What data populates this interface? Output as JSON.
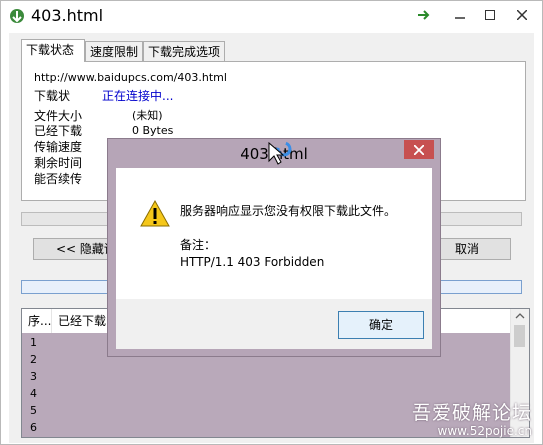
{
  "window": {
    "title": "403.html"
  },
  "tabs": [
    {
      "label": "下载状态"
    },
    {
      "label": "速度限制"
    },
    {
      "label": "下载完成选项"
    }
  ],
  "status": {
    "url": "http://www.baidupcs.com/403.html",
    "state_label": "下载状",
    "state_value": "正在连接中...",
    "rows": [
      {
        "label": "文件大小",
        "value": "(未知)"
      },
      {
        "label": "已经下载",
        "value": "0 Bytes"
      },
      {
        "label": "传输速度",
        "value": ""
      },
      {
        "label": "剩余时间",
        "value": ""
      },
      {
        "label": "能否续传",
        "value": ""
      }
    ]
  },
  "buttons": {
    "hide_details": "<< 隐藏详",
    "cancel": "取消"
  },
  "list": {
    "columns": [
      "序...",
      "已经下载"
    ],
    "rows": [
      "1",
      "2",
      "3",
      "4",
      "5",
      "6"
    ]
  },
  "dialog": {
    "title": "403.html",
    "message": "服务器响应显示您没有权限下载此文件。",
    "note_label": "备注：",
    "note_value": "HTTP/1.1 403 Forbidden",
    "ok": "确定"
  },
  "watermark": {
    "cn": "吾爱破解论坛",
    "url": "www.52pojie.cn"
  },
  "colors": {
    "accent": "#0000cc",
    "close": "#c75050",
    "overlay": "#b6a5b7"
  }
}
